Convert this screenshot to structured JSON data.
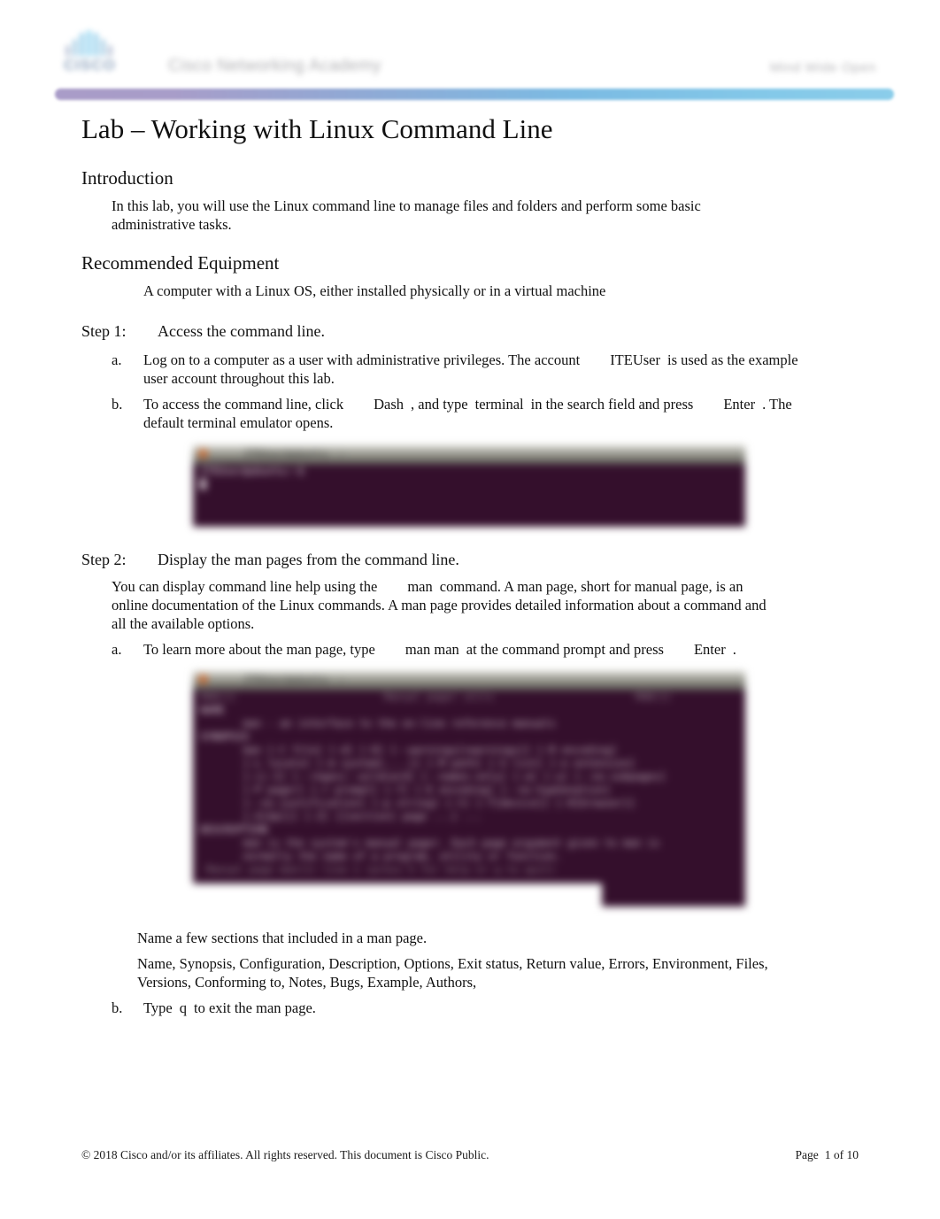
{
  "header": {
    "logo_wordmark": "CISCO",
    "brand": "Cisco Networking Academy",
    "tagline": "Mind Wide Open",
    "accent_left": "#a99cc8",
    "accent_right": "#8bcdea"
  },
  "document": {
    "title": "Lab – Working with Linux Command Line"
  },
  "introduction": {
    "heading": "Introduction",
    "body": "In this lab, you will use the Linux command line to manage files and folders and perform some basic administrative tasks."
  },
  "equipment": {
    "heading": "Recommended Equipment",
    "bullet_glyph": "",
    "items": [
      "A computer with a Linux OS, either installed physically or in a virtual machine"
    ]
  },
  "step1": {
    "label": "Step 1:",
    "title": "Access the command line.",
    "items": [
      {
        "marker": "a.",
        "text_before": "Log on to a computer as a user with administrative privileges. The account",
        "emphasis": "ITEUser",
        "text_after": "is used as the example user account throughout this lab."
      },
      {
        "marker": "b.",
        "part1": "To access the command line, click",
        "kbd1": "Dash",
        "part2": ", and type",
        "kbd2": "terminal",
        "part3": "in the search field and press",
        "kbd3": "Enter",
        "part4": ". The default terminal emulator opens."
      }
    ]
  },
  "screenshot1": {
    "alt": "ubuntu-terminal-window",
    "titlebar": "ITEUser@ubuntu: ~",
    "lines": [
      "ITEUser@ubuntu:~$",
      ""
    ]
  },
  "step2": {
    "label": "Step 2:",
    "title": "Display the man pages from the command line.",
    "intro_part1": "You can display command line help using the",
    "intro_kbd": "man",
    "intro_part2": "command. A man page, short for manual page, is an online documentation of the Linux commands. A man page provides detailed information about a command and all the available options.",
    "items": [
      {
        "marker": "a.",
        "part1": "To learn more about the man page, type",
        "kbd1": "man man",
        "part2": "at the command prompt and press",
        "kbd2": "Enter",
        "part3": "."
      },
      {
        "marker": "b.",
        "part1": "Type",
        "kbd1": "q",
        "part2": "to exit the man page."
      }
    ],
    "question": "Name a few sections that included in a man page.",
    "answer": "Name, Synopsis, Configuration, Description, Options, Exit status, Return value, Errors, Environment, Files, Versions, Conforming to, Notes, Bugs, Example, Authors,"
  },
  "screenshot2": {
    "alt": "ubuntu-terminal-man-page",
    "titlebar": "ITEUser@ubuntu: ~",
    "lines": [
      "MAN(1)                        Manual pager utils                       MAN(1)",
      "",
      "NAME",
      "       man - an interface to the on-line reference manuals",
      "",
      "SYNOPSIS",
      "       man [-C file] [-d] [-D] [--warnings[=warnings]] [-R encoding]",
      "       [-L locale] [-m system[,...]] [-M path] [-S list] [-e extension]",
      "       [-i|-I] [--regex|--wildcard] [--names-only] [-a] [-u] [--no-subpages]",
      "       [-P pager] [-r prompt] [-7] [-E encoding] [--no-hyphenation]",
      "       [--no-justification] [-p string] [-t] [-T[device]] [-H[browser]]",
      "       [-X[dpi]] [-Z] [[section] page ...] ...",
      "",
      "DESCRIPTION",
      "       man is the system's manual pager. Each page argument given to man is",
      "       normally the name of a program, utility or function.",
      " Manual page man(1) line 1 (press h for help or q to quit)"
    ]
  },
  "footer": {
    "copyright": "© 2018 Cisco and/or its affiliates. All rights reserved. This document is Cisco Public.",
    "page_label": "Page",
    "page_number": "1",
    "page_of": "of",
    "page_total": "10"
  }
}
